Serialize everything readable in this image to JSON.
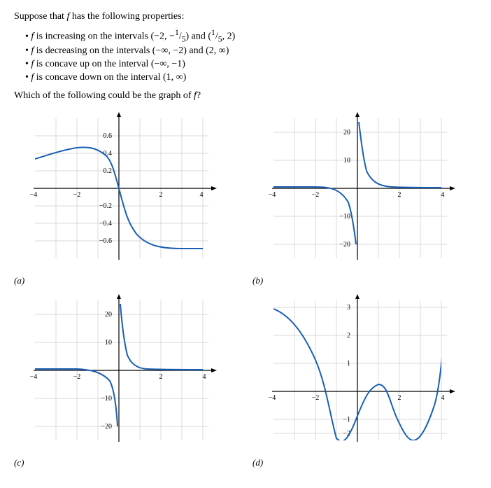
{
  "intro": "Suppose that f has the following properties:",
  "properties": [
    "f is increasing on the intervals (−2, −1/5) and (1/5, 2)",
    "f is decreasing on the intervals (−∞, −2) and (2, ∞)",
    "f is concave up on the interval (−∞, −1)",
    "f is concave down on the interval (1, ∞)"
  ],
  "question": "Which of the following could be the graph of f?",
  "graph_labels": [
    "(a)",
    "(b)",
    "(c)",
    "(d)"
  ]
}
